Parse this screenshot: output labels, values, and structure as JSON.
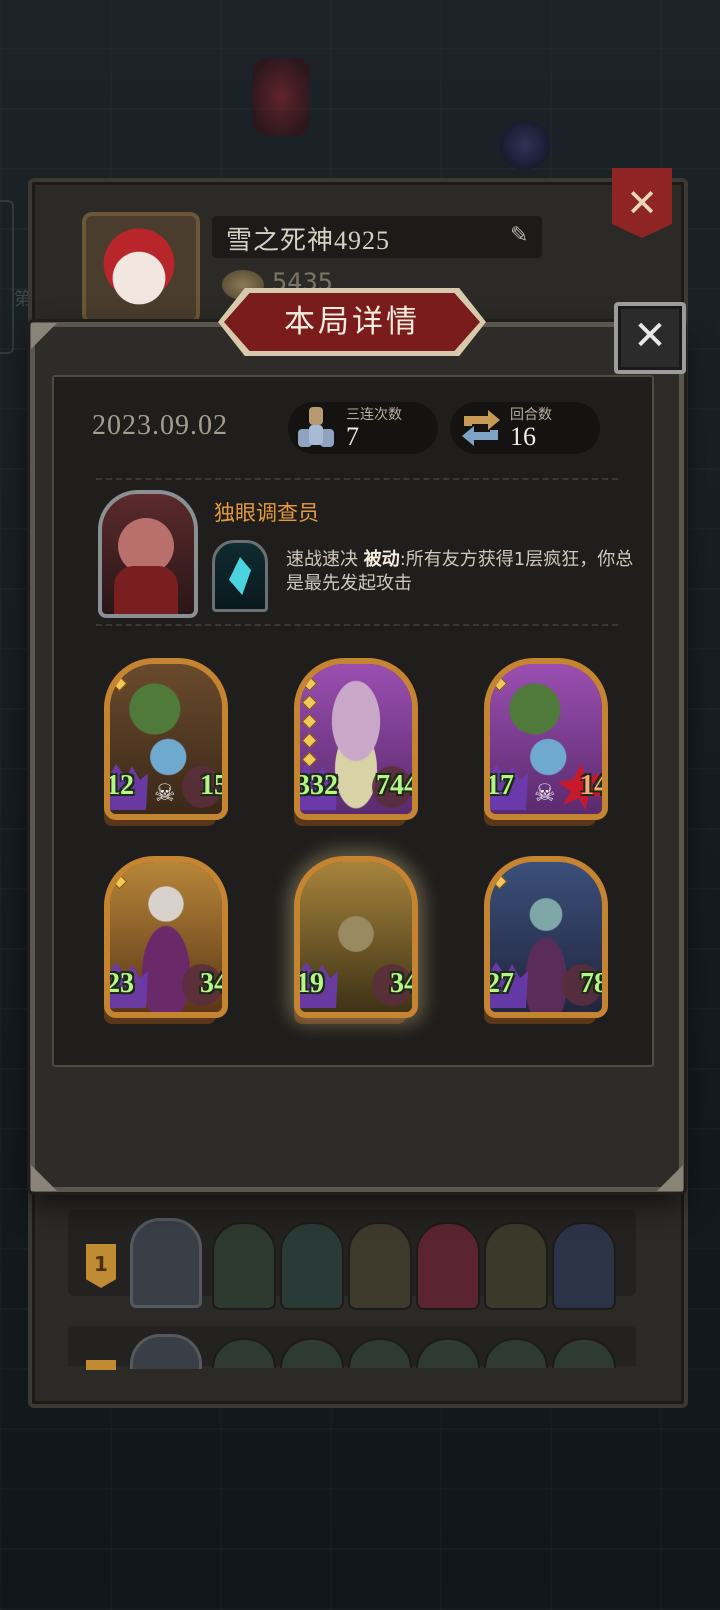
{
  "profile": {
    "player_name": "雪之死神4925",
    "coins": "5435",
    "side_tab_text": "第"
  },
  "list": {
    "rows": [
      {
        "rank": "1"
      }
    ]
  },
  "modal": {
    "title": "本局详情",
    "date": "2023.09.02",
    "stats": {
      "triples_label": "三连次数",
      "triples_value": "7",
      "rounds_label": "回合数",
      "rounds_value": "16"
    },
    "hero": {
      "name": "独眼调查员",
      "skill_name": "速战速决",
      "skill_type": "被动",
      "skill_desc": ":所有友方获得1层疯狂，你总是最先发起攻击"
    },
    "units": [
      {
        "attack": "12",
        "health": "15",
        "art": "vine-blue",
        "gems": 1,
        "skull": true,
        "health_style": "shield"
      },
      {
        "attack": "332",
        "health": "744",
        "art": "mushroom-purple",
        "gems": 5,
        "skull": false,
        "health_style": "shield"
      },
      {
        "attack": "17",
        "health": "14",
        "art": "vine-purple",
        "gems": 1,
        "skull": true,
        "health_style": "burst"
      },
      {
        "attack": "23",
        "health": "34",
        "art": "jester",
        "gems": 1,
        "skull": false,
        "health_style": "shield"
      },
      {
        "attack": "19",
        "health": "34",
        "art": "witch",
        "gems": 0,
        "skull": false,
        "health_style": "shield"
      },
      {
        "attack": "27",
        "health": "78",
        "art": "elf",
        "gems": 1,
        "skull": false,
        "health_style": "shield"
      }
    ]
  },
  "colors": {
    "banner_red": "#7a1c1c",
    "card_gold": "#c48431",
    "stat_green": "#b7f58a",
    "hero_name_orange": "#e59a3c"
  },
  "icons": {
    "close": "close-icon",
    "pencil": "pencil-icon",
    "coin": "coin-icon",
    "triple": "triple-merge-icon",
    "rounds": "rounds-cycle-icon",
    "skull": "skull-icon"
  }
}
